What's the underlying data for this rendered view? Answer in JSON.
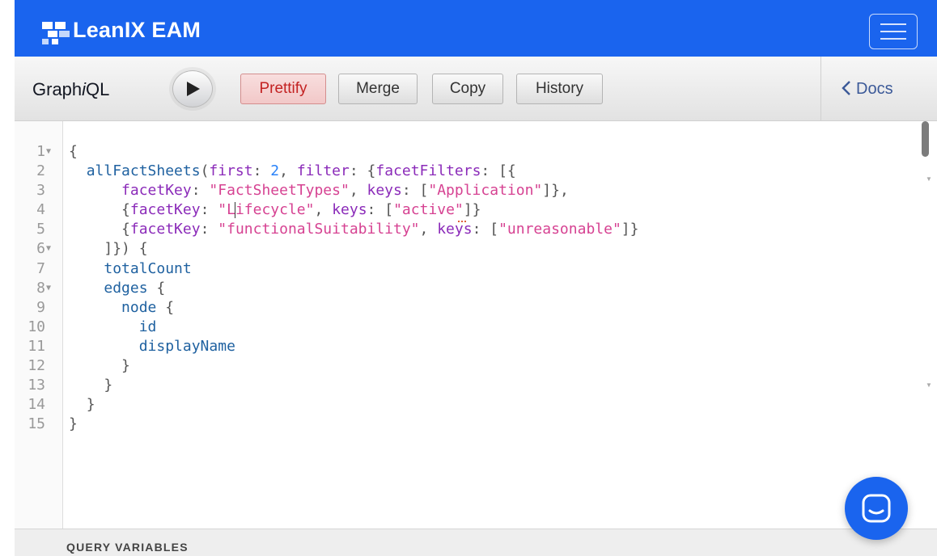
{
  "brand": {
    "name": "LeanIX EAM"
  },
  "toolbar": {
    "title_prefix": "Graph",
    "title_italic": "i",
    "title_suffix": "QL",
    "buttons": {
      "prettify": "Prettify",
      "merge": "Merge",
      "copy": "Copy",
      "history": "History"
    },
    "docs_label": "Docs"
  },
  "editor": {
    "line_numbers": [
      "1",
      "2",
      "3",
      "4",
      "5",
      "6",
      "7",
      "8",
      "9",
      "10",
      "11",
      "12",
      "13",
      "14",
      "15"
    ],
    "lines": [
      [
        "{"
      ],
      [
        "allFactSheets",
        "(",
        "first",
        ": ",
        "2",
        ", ",
        "filter",
        ": {",
        "facetFilters",
        ": [{"
      ],
      [
        "facetKey",
        ": ",
        "\"FactSheetTypes\"",
        ", ",
        "keys",
        ": [",
        "\"Application\"",
        "]},"
      ],
      [
        "{",
        "facetKey",
        ": ",
        "\"L",
        "ifecycle\"",
        ", ",
        "keys",
        ": [",
        "\"active\"",
        "]}"
      ],
      [
        "{",
        "facetKey",
        ": ",
        "\"functionalSuitability\"",
        ", ",
        "keys",
        ": [",
        "\"unreasonable\"",
        "]}"
      ],
      [
        "]}) {"
      ],
      [
        "totalCount"
      ],
      [
        "edges",
        " {"
      ],
      [
        "node",
        " {"
      ],
      [
        "id"
      ],
      [
        "displayName"
      ],
      [
        "}"
      ],
      [
        "}"
      ],
      [
        "}"
      ],
      [
        "}"
      ]
    ]
  },
  "query_variables": {
    "title": "QUERY VARIABLES"
  },
  "icons": {
    "brand_logo": "leanix-logo-icon",
    "menu": "hamburger-menu-icon",
    "execute": "play-icon",
    "docs": "chevron-left-icon",
    "chat": "chat-icon"
  },
  "colors": {
    "brand_blue": "#1a64ee",
    "prettify_text": "#c32222",
    "field": "#1f61a0",
    "argument": "#8b2bb9",
    "number": "#2882f9",
    "string": "#d64292"
  }
}
